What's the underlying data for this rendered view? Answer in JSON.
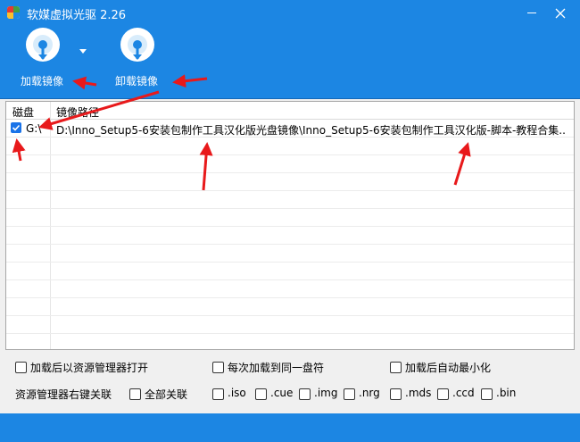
{
  "window": {
    "title": "软媒虚拟光驱 2.26"
  },
  "toolbar": {
    "load_label": "加载镜像",
    "unload_label": "卸载镜像"
  },
  "table": {
    "headers": [
      "磁盘",
      "镜像路径"
    ],
    "rows": [
      {
        "checked": true,
        "drive": "G:\\",
        "path": "D:\\Inno_Setup5-6安装包制作工具汉化版光盘镜像\\Inno_Setup5-6安装包制作工具汉化版-脚本-教程合集..."
      }
    ]
  },
  "options": {
    "open_explorer": "加载后以资源管理器打开",
    "same_drive": "每次加载到同一盘符",
    "minimize": "加载后自动最小化",
    "assoc_label": "资源管理器右键关联",
    "assoc_all": "全部关联",
    "ext": [
      ".iso",
      ".cue",
      ".img",
      ".nrg",
      ".mds",
      ".ccd",
      ".bin"
    ]
  },
  "colors": {
    "accent": "#1c86e3",
    "annotation": "#e8191b",
    "checkbox": "#1a73e8"
  }
}
